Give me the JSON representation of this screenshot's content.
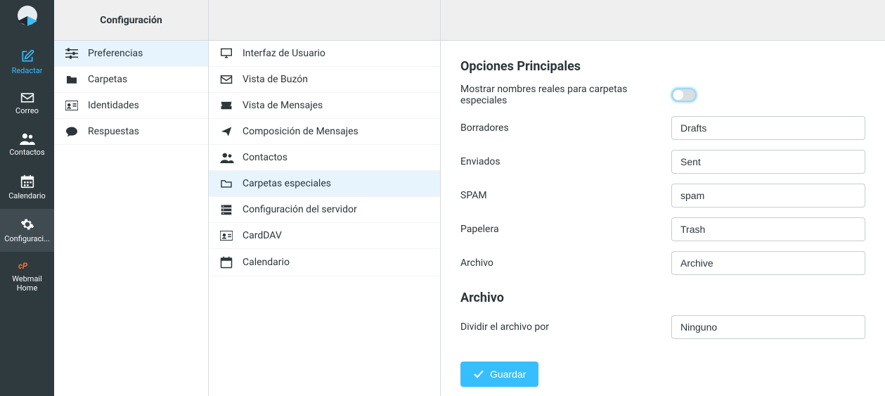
{
  "nav": {
    "items": [
      {
        "label": "Redactar",
        "icon": "edit"
      },
      {
        "label": "Correo",
        "icon": "envelope"
      },
      {
        "label": "Contactos",
        "icon": "users"
      },
      {
        "label": "Calendario",
        "icon": "calendar"
      },
      {
        "label": "Configuraci...",
        "icon": "gear"
      },
      {
        "label": "Webmail Home",
        "icon": "cpanel"
      }
    ]
  },
  "settings_header": "Configuración",
  "settings": {
    "items": [
      {
        "label": "Preferencias",
        "icon": "sliders"
      },
      {
        "label": "Carpetas",
        "icon": "folder-solid"
      },
      {
        "label": "Identidades",
        "icon": "id-card"
      },
      {
        "label": "Respuestas",
        "icon": "comment"
      }
    ],
    "selected": 0
  },
  "prefs": {
    "items": [
      {
        "label": "Interfaz de Usuario",
        "icon": "desktop"
      },
      {
        "label": "Vista de Buzón",
        "icon": "envelope"
      },
      {
        "label": "Vista de Mensajes",
        "icon": "inbox"
      },
      {
        "label": "Composición de Mensajes",
        "icon": "send"
      },
      {
        "label": "Contactos",
        "icon": "users"
      },
      {
        "label": "Carpetas especiales",
        "icon": "folder-outline"
      },
      {
        "label": "Configuración del servidor",
        "icon": "server"
      },
      {
        "label": "CardDAV",
        "icon": "vcard"
      },
      {
        "label": "Calendario",
        "icon": "calendar"
      }
    ],
    "selected": 5
  },
  "main": {
    "section1_title": "Opciones Principales",
    "toggle_label": "Mostrar nombres reales para carpetas especia­les",
    "toggle_value": false,
    "fields": [
      {
        "label": "Borradores",
        "value": "Drafts"
      },
      {
        "label": "Enviados",
        "value": "Sent"
      },
      {
        "label": "SPAM",
        "value": "spam"
      },
      {
        "label": "Papelera",
        "value": "Trash"
      },
      {
        "label": "Archivo",
        "value": "Archive"
      }
    ],
    "section2_title": "Archivo",
    "archive_divide_label": "Dividir el archivo por",
    "archive_divide_value": "Ninguno",
    "save_label": "Guardar"
  }
}
